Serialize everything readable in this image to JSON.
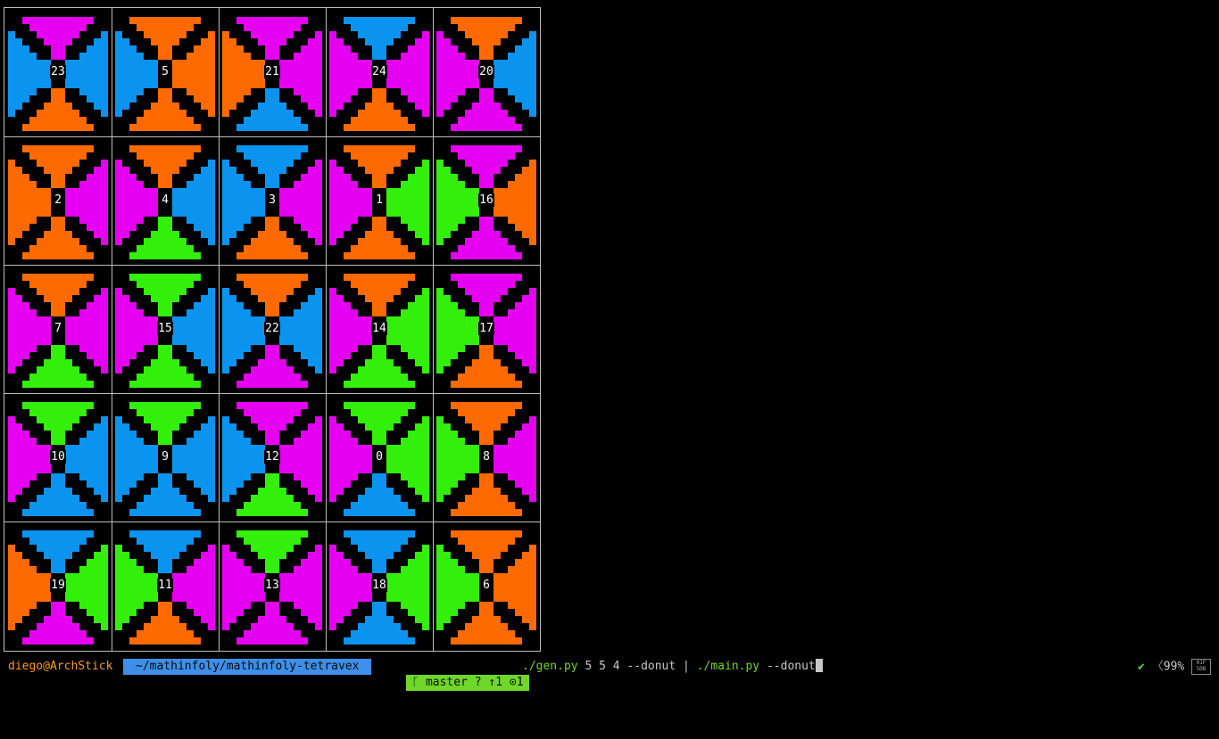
{
  "colors": {
    "O": "#ff6a00",
    "B": "#0a94f0",
    "M": "#e600f2",
    "G": "#33f00a",
    "bg": "#000000",
    "grid_line": "#bdbdbd"
  },
  "board": {
    "rows": [
      [
        {
          "num": "23",
          "top": "M",
          "left": "B",
          "right": "B",
          "bottom": "O"
        },
        {
          "num": "5",
          "top": "O",
          "left": "B",
          "right": "O",
          "bottom": "O"
        },
        {
          "num": "21",
          "top": "M",
          "left": "O",
          "right": "M",
          "bottom": "B"
        },
        {
          "num": "24",
          "top": "B",
          "left": "M",
          "right": "M",
          "bottom": "O"
        },
        {
          "num": "20",
          "top": "O",
          "left": "M",
          "right": "B",
          "bottom": "M"
        }
      ],
      [
        {
          "num": "2",
          "top": "O",
          "left": "O",
          "right": "M",
          "bottom": "O"
        },
        {
          "num": "4",
          "top": "O",
          "left": "M",
          "right": "B",
          "bottom": "G"
        },
        {
          "num": "3",
          "top": "B",
          "left": "B",
          "right": "M",
          "bottom": "O"
        },
        {
          "num": "1",
          "top": "O",
          "left": "M",
          "right": "G",
          "bottom": "O"
        },
        {
          "num": "16",
          "top": "M",
          "left": "G",
          "right": "O",
          "bottom": "M"
        }
      ],
      [
        {
          "num": "7",
          "top": "O",
          "left": "M",
          "right": "M",
          "bottom": "G"
        },
        {
          "num": "15",
          "top": "G",
          "left": "M",
          "right": "B",
          "bottom": "G"
        },
        {
          "num": "22",
          "top": "O",
          "left": "B",
          "right": "B",
          "bottom": "M"
        },
        {
          "num": "14",
          "top": "O",
          "left": "M",
          "right": "G",
          "bottom": "G"
        },
        {
          "num": "17",
          "top": "M",
          "left": "G",
          "right": "M",
          "bottom": "O"
        }
      ],
      [
        {
          "num": "10",
          "top": "G",
          "left": "M",
          "right": "B",
          "bottom": "B"
        },
        {
          "num": "9",
          "top": "G",
          "left": "B",
          "right": "B",
          "bottom": "B"
        },
        {
          "num": "12",
          "top": "M",
          "left": "B",
          "right": "M",
          "bottom": "G"
        },
        {
          "num": "0",
          "top": "G",
          "left": "M",
          "right": "G",
          "bottom": "B"
        },
        {
          "num": "8",
          "top": "O",
          "left": "G",
          "right": "M",
          "bottom": "O"
        }
      ],
      [
        {
          "num": "19",
          "top": "B",
          "left": "O",
          "right": "G",
          "bottom": "M"
        },
        {
          "num": "11",
          "top": "B",
          "left": "G",
          "right": "M",
          "bottom": "O"
        },
        {
          "num": "13",
          "top": "G",
          "left": "M",
          "right": "M",
          "bottom": "M"
        },
        {
          "num": "18",
          "top": "B",
          "left": "M",
          "right": "G",
          "bottom": "B"
        },
        {
          "num": "6",
          "top": "O",
          "left": "G",
          "right": "O",
          "bottom": "O"
        }
      ]
    ]
  },
  "prompt": {
    "user_host": "diego@ArchStick",
    "path": "~/mathinfoly/mathinfoly-tetravex",
    "git_icon": "branch-icon",
    "git": " master ? ↑1 ⊙1",
    "cmd_part1": "./gen.py",
    "cmd_part2": " 5 5 4 --donut | ",
    "cmd_part3": "./main.py",
    "cmd_part4": " --donut"
  },
  "status": {
    "check": "✔",
    "chevron": "〈",
    "battery": "99%",
    "clock_line1": "01F",
    "clock_line2": "5DB"
  }
}
